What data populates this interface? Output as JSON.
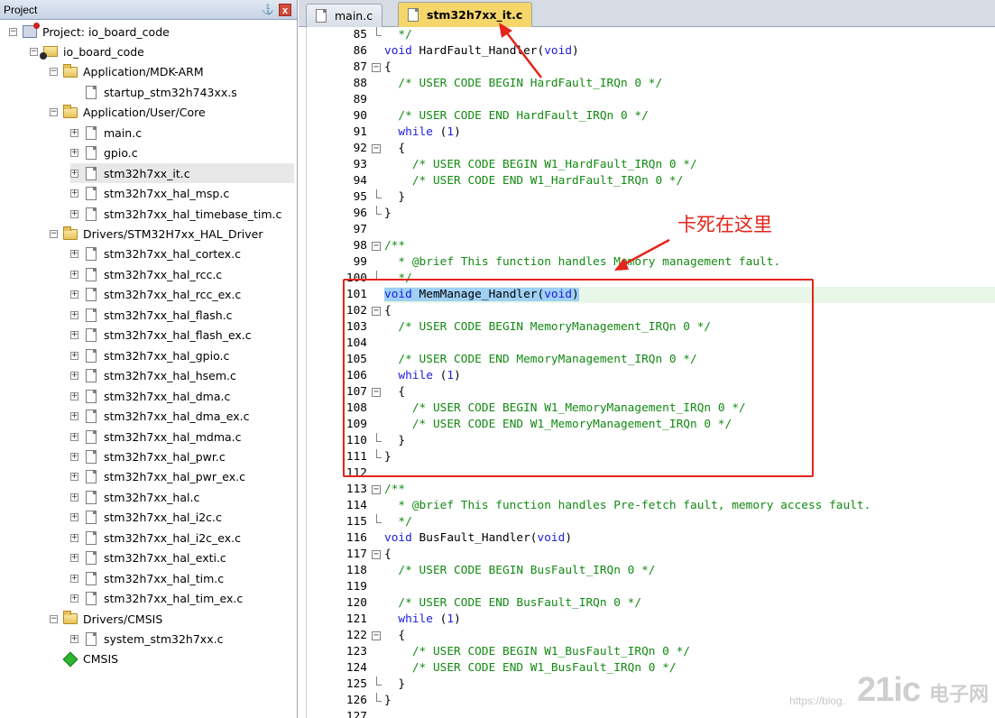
{
  "project_panel": {
    "title": "Project",
    "pin": "⚓",
    "close": "x",
    "tree": [
      {
        "label": "Project: io_board_code",
        "icon": "project-icon",
        "level": 0,
        "expander": "-"
      },
      {
        "label": "io_board_code",
        "icon": "target-icon",
        "level": 1,
        "expander": "-"
      },
      {
        "label": "Application/MDK-ARM",
        "icon": "folder-icon",
        "level": 2,
        "expander": "-"
      },
      {
        "label": "startup_stm32h743xx.s",
        "icon": "file-icon",
        "level": 3,
        "expander": ""
      },
      {
        "label": "Application/User/Core",
        "icon": "folder-icon",
        "level": 2,
        "expander": "-"
      },
      {
        "label": "main.c",
        "icon": "file-icon",
        "level": 3,
        "expander": "+"
      },
      {
        "label": "gpio.c",
        "icon": "file-icon",
        "level": 3,
        "expander": "+"
      },
      {
        "label": "stm32h7xx_it.c",
        "icon": "file-icon",
        "level": 3,
        "expander": "+",
        "selected": true
      },
      {
        "label": "stm32h7xx_hal_msp.c",
        "icon": "file-icon",
        "level": 3,
        "expander": "+"
      },
      {
        "label": "stm32h7xx_hal_timebase_tim.c",
        "icon": "file-gear-icon",
        "level": 3,
        "expander": "+"
      },
      {
        "label": "Drivers/STM32H7xx_HAL_Driver",
        "icon": "folder-icon",
        "level": 2,
        "expander": "-"
      },
      {
        "label": "stm32h7xx_hal_cortex.c",
        "icon": "file-icon",
        "level": 3,
        "expander": "+"
      },
      {
        "label": "stm32h7xx_hal_rcc.c",
        "icon": "file-icon",
        "level": 3,
        "expander": "+"
      },
      {
        "label": "stm32h7xx_hal_rcc_ex.c",
        "icon": "file-icon",
        "level": 3,
        "expander": "+"
      },
      {
        "label": "stm32h7xx_hal_flash.c",
        "icon": "file-icon",
        "level": 3,
        "expander": "+"
      },
      {
        "label": "stm32h7xx_hal_flash_ex.c",
        "icon": "file-icon",
        "level": 3,
        "expander": "+"
      },
      {
        "label": "stm32h7xx_hal_gpio.c",
        "icon": "file-icon",
        "level": 3,
        "expander": "+"
      },
      {
        "label": "stm32h7xx_hal_hsem.c",
        "icon": "file-icon",
        "level": 3,
        "expander": "+"
      },
      {
        "label": "stm32h7xx_hal_dma.c",
        "icon": "file-icon",
        "level": 3,
        "expander": "+"
      },
      {
        "label": "stm32h7xx_hal_dma_ex.c",
        "icon": "file-icon",
        "level": 3,
        "expander": "+"
      },
      {
        "label": "stm32h7xx_hal_mdma.c",
        "icon": "file-icon",
        "level": 3,
        "expander": "+"
      },
      {
        "label": "stm32h7xx_hal_pwr.c",
        "icon": "file-icon",
        "level": 3,
        "expander": "+"
      },
      {
        "label": "stm32h7xx_hal_pwr_ex.c",
        "icon": "file-icon",
        "level": 3,
        "expander": "+"
      },
      {
        "label": "stm32h7xx_hal.c",
        "icon": "file-icon",
        "level": 3,
        "expander": "+"
      },
      {
        "label": "stm32h7xx_hal_i2c.c",
        "icon": "file-icon",
        "level": 3,
        "expander": "+"
      },
      {
        "label": "stm32h7xx_hal_i2c_ex.c",
        "icon": "file-icon",
        "level": 3,
        "expander": "+"
      },
      {
        "label": "stm32h7xx_hal_exti.c",
        "icon": "file-icon",
        "level": 3,
        "expander": "+"
      },
      {
        "label": "stm32h7xx_hal_tim.c",
        "icon": "file-icon",
        "level": 3,
        "expander": "+"
      },
      {
        "label": "stm32h7xx_hal_tim_ex.c",
        "icon": "file-icon",
        "level": 3,
        "expander": "+"
      },
      {
        "label": "Drivers/CMSIS",
        "icon": "folder-icon",
        "level": 2,
        "expander": "-"
      },
      {
        "label": "system_stm32h7xx.c",
        "icon": "file-icon",
        "level": 3,
        "expander": "+"
      },
      {
        "label": "CMSIS",
        "icon": "cmsis-icon",
        "level": 2,
        "expander": ""
      }
    ]
  },
  "editor": {
    "tabs": [
      {
        "label": "main.c",
        "active": false
      },
      {
        "label": "stm32h7xx_it.c",
        "active": true
      }
    ],
    "lines": [
      {
        "n": "85",
        "fold": "end",
        "segs": [
          [
            "cm",
            "  */"
          ]
        ]
      },
      {
        "n": "86",
        "fold": "",
        "segs": [
          [
            "kw",
            "void"
          ],
          [
            "",
            " HardFault_Handler("
          ],
          [
            "kw",
            "void"
          ],
          [
            "",
            ")"
          ]
        ]
      },
      {
        "n": "87",
        "fold": "-",
        "segs": [
          [
            "",
            "{"
          ]
        ]
      },
      {
        "n": "88",
        "fold": "",
        "segs": [
          [
            "",
            "  "
          ],
          [
            "cm",
            "/* USER CODE BEGIN HardFault_IRQn 0 */"
          ]
        ]
      },
      {
        "n": "89",
        "fold": "",
        "segs": []
      },
      {
        "n": "90",
        "fold": "",
        "segs": [
          [
            "",
            "  "
          ],
          [
            "cm",
            "/* USER CODE END HardFault_IRQn 0 */"
          ]
        ]
      },
      {
        "n": "91",
        "fold": "",
        "segs": [
          [
            "",
            "  "
          ],
          [
            "kw",
            "while"
          ],
          [
            "",
            " ("
          ],
          [
            "kw",
            "1"
          ],
          [
            "",
            ")"
          ]
        ]
      },
      {
        "n": "92",
        "fold": "-",
        "segs": [
          [
            "",
            "  {"
          ]
        ]
      },
      {
        "n": "93",
        "fold": "",
        "segs": [
          [
            "",
            "    "
          ],
          [
            "cm",
            "/* USER CODE BEGIN W1_HardFault_IRQn 0 */"
          ]
        ]
      },
      {
        "n": "94",
        "fold": "",
        "segs": [
          [
            "",
            "    "
          ],
          [
            "cm",
            "/* USER CODE END W1_HardFault_IRQn 0 */"
          ]
        ]
      },
      {
        "n": "95",
        "fold": "end",
        "segs": [
          [
            "",
            "  }"
          ]
        ]
      },
      {
        "n": "96",
        "fold": "end",
        "segs": [
          [
            "",
            "}"
          ]
        ]
      },
      {
        "n": "97",
        "fold": "",
        "segs": []
      },
      {
        "n": "98",
        "fold": "-",
        "segs": [
          [
            "cm",
            "/**"
          ]
        ]
      },
      {
        "n": "99",
        "fold": "",
        "segs": [
          [
            "cm",
            "  * @brief This function handles Memory management fault."
          ]
        ]
      },
      {
        "n": "100",
        "fold": "end",
        "segs": [
          [
            "cm",
            "  */"
          ]
        ]
      },
      {
        "n": "101",
        "fold": "",
        "hl": true,
        "segs": [
          [
            "kw sel-hl",
            "void"
          ],
          [
            "sel-hl",
            " MemManage_Handler("
          ],
          [
            "kw sel-hl",
            "void"
          ],
          [
            "sel-hl",
            ")"
          ]
        ]
      },
      {
        "n": "102",
        "fold": "-",
        "segs": [
          [
            "",
            "{"
          ]
        ]
      },
      {
        "n": "103",
        "fold": "",
        "segs": [
          [
            "",
            "  "
          ],
          [
            "cm",
            "/* USER CODE BEGIN MemoryManagement_IRQn 0 */"
          ]
        ]
      },
      {
        "n": "104",
        "fold": "",
        "segs": []
      },
      {
        "n": "105",
        "fold": "",
        "segs": [
          [
            "",
            "  "
          ],
          [
            "cm",
            "/* USER CODE END MemoryManagement_IRQn 0 */"
          ]
        ]
      },
      {
        "n": "106",
        "fold": "",
        "segs": [
          [
            "",
            "  "
          ],
          [
            "kw",
            "while"
          ],
          [
            "",
            " ("
          ],
          [
            "kw",
            "1"
          ],
          [
            "",
            ")"
          ]
        ]
      },
      {
        "n": "107",
        "fold": "-",
        "segs": [
          [
            "",
            "  {"
          ]
        ]
      },
      {
        "n": "108",
        "fold": "",
        "segs": [
          [
            "",
            "    "
          ],
          [
            "cm",
            "/* USER CODE BEGIN W1_MemoryManagement_IRQn 0 */"
          ]
        ]
      },
      {
        "n": "109",
        "fold": "",
        "segs": [
          [
            "",
            "    "
          ],
          [
            "cm",
            "/* USER CODE END W1_MemoryManagement_IRQn 0 */"
          ]
        ]
      },
      {
        "n": "110",
        "fold": "end",
        "segs": [
          [
            "",
            "  }"
          ]
        ]
      },
      {
        "n": "111",
        "fold": "end",
        "segs": [
          [
            "",
            "}"
          ]
        ]
      },
      {
        "n": "112",
        "fold": "",
        "segs": []
      },
      {
        "n": "113",
        "fold": "-",
        "segs": [
          [
            "cm",
            "/**"
          ]
        ]
      },
      {
        "n": "114",
        "fold": "",
        "segs": [
          [
            "cm",
            "  * @brief This function handles Pre-fetch fault, memory access fault."
          ]
        ]
      },
      {
        "n": "115",
        "fold": "end",
        "segs": [
          [
            "cm",
            "  */"
          ]
        ]
      },
      {
        "n": "116",
        "fold": "",
        "segs": [
          [
            "kw",
            "void"
          ],
          [
            "",
            " BusFault_Handler("
          ],
          [
            "kw",
            "void"
          ],
          [
            "",
            ")"
          ]
        ]
      },
      {
        "n": "117",
        "fold": "-",
        "segs": [
          [
            "",
            "{"
          ]
        ]
      },
      {
        "n": "118",
        "fold": "",
        "segs": [
          [
            "",
            "  "
          ],
          [
            "cm",
            "/* USER CODE BEGIN BusFault_IRQn 0 */"
          ]
        ]
      },
      {
        "n": "119",
        "fold": "",
        "segs": []
      },
      {
        "n": "120",
        "fold": "",
        "segs": [
          [
            "",
            "  "
          ],
          [
            "cm",
            "/* USER CODE END BusFault_IRQn 0 */"
          ]
        ]
      },
      {
        "n": "121",
        "fold": "",
        "segs": [
          [
            "",
            "  "
          ],
          [
            "kw",
            "while"
          ],
          [
            "",
            " ("
          ],
          [
            "kw",
            "1"
          ],
          [
            "",
            ")"
          ]
        ]
      },
      {
        "n": "122",
        "fold": "-",
        "segs": [
          [
            "",
            "  {"
          ]
        ]
      },
      {
        "n": "123",
        "fold": "",
        "segs": [
          [
            "",
            "    "
          ],
          [
            "cm",
            "/* USER CODE BEGIN W1_BusFault_IRQn 0 */"
          ]
        ]
      },
      {
        "n": "124",
        "fold": "",
        "segs": [
          [
            "",
            "    "
          ],
          [
            "cm",
            "/* USER CODE END W1_BusFault_IRQn 0 */"
          ]
        ]
      },
      {
        "n": "125",
        "fold": "end",
        "segs": [
          [
            "",
            "  }"
          ]
        ]
      },
      {
        "n": "126",
        "fold": "end",
        "segs": [
          [
            "",
            "}"
          ]
        ]
      },
      {
        "n": "127",
        "fold": "",
        "segs": []
      }
    ]
  },
  "annotation": {
    "text": "卡死在这里",
    "color": "#e3251a"
  },
  "watermark": {
    "url_text": "https://blog.",
    "logo": "21ic",
    "cn": "电子网"
  },
  "colors": {
    "keyword": "#1d1ddf",
    "comment": "#128a12",
    "highlight": "#9fd0f5",
    "active_tab": "#f5d66a"
  }
}
